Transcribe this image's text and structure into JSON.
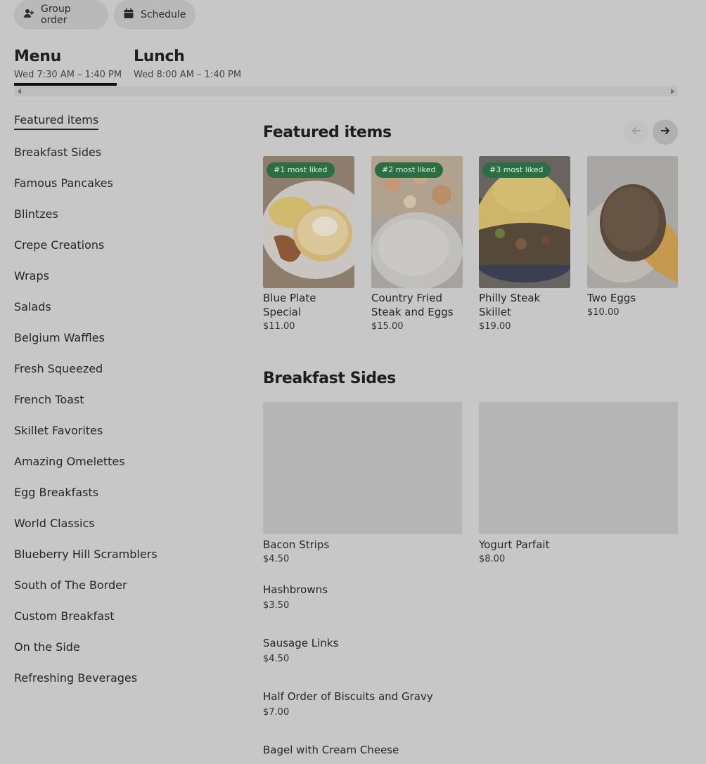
{
  "top_buttons": {
    "group_order": "Group order",
    "schedule": "Schedule"
  },
  "menus": [
    {
      "title": "Menu",
      "hours": "Wed 7:30 AM – 1:40 PM"
    },
    {
      "title": "Lunch",
      "hours": "Wed 8:00 AM – 1:40 PM"
    }
  ],
  "sidebar": {
    "items": [
      {
        "label": "Featured items"
      },
      {
        "label": "Breakfast Sides"
      },
      {
        "label": "Famous Pancakes"
      },
      {
        "label": "Blintzes"
      },
      {
        "label": "Crepe Creations"
      },
      {
        "label": "Wraps"
      },
      {
        "label": "Salads"
      },
      {
        "label": "Belgium Waffles"
      },
      {
        "label": "Fresh Squeezed"
      },
      {
        "label": "French Toast"
      },
      {
        "label": "Skillet Favorites"
      },
      {
        "label": "Amazing Omelettes"
      },
      {
        "label": "Egg Breakfasts"
      },
      {
        "label": "World Classics"
      },
      {
        "label": "Blueberry Hill Scramblers"
      },
      {
        "label": "South of The Border"
      },
      {
        "label": "Custom Breakfast"
      },
      {
        "label": "On the Side"
      },
      {
        "label": "Refreshing Beverages"
      }
    ]
  },
  "featured": {
    "heading": "Featured items",
    "items": [
      {
        "badge": "#1 most liked",
        "name": "Blue Plate Special",
        "price": "$11.00"
      },
      {
        "badge": "#2 most liked",
        "name": "Country Fried Steak and Eggs",
        "price": "$15.00"
      },
      {
        "badge": "#3 most liked",
        "name": "Philly Steak Skillet",
        "price": "$19.00"
      },
      {
        "badge": "",
        "name": "Two Eggs",
        "price": "$10.00"
      }
    ]
  },
  "breakfast_sides": {
    "heading": "Breakfast Sides",
    "tiles": [
      {
        "name": "Bacon Strips",
        "price": "$4.50"
      },
      {
        "name": "Yogurt Parfait",
        "price": "$8.00"
      }
    ],
    "list": [
      {
        "name": "Hashbrowns",
        "price": "$3.50"
      },
      {
        "name": "Sausage Links",
        "price": "$4.50"
      },
      {
        "name": "Half Order of Biscuits and Gravy",
        "price": "$7.00"
      },
      {
        "name": "Bagel with Cream Cheese",
        "price": ""
      }
    ]
  },
  "icons": {
    "group_order": "person-plus-icon",
    "schedule": "calendar-icon",
    "prev": "arrow-left-icon",
    "next": "arrow-right-icon"
  },
  "colors": {
    "overlay_bg": "#c7c7c7",
    "badge_green": "#2c6e43"
  }
}
